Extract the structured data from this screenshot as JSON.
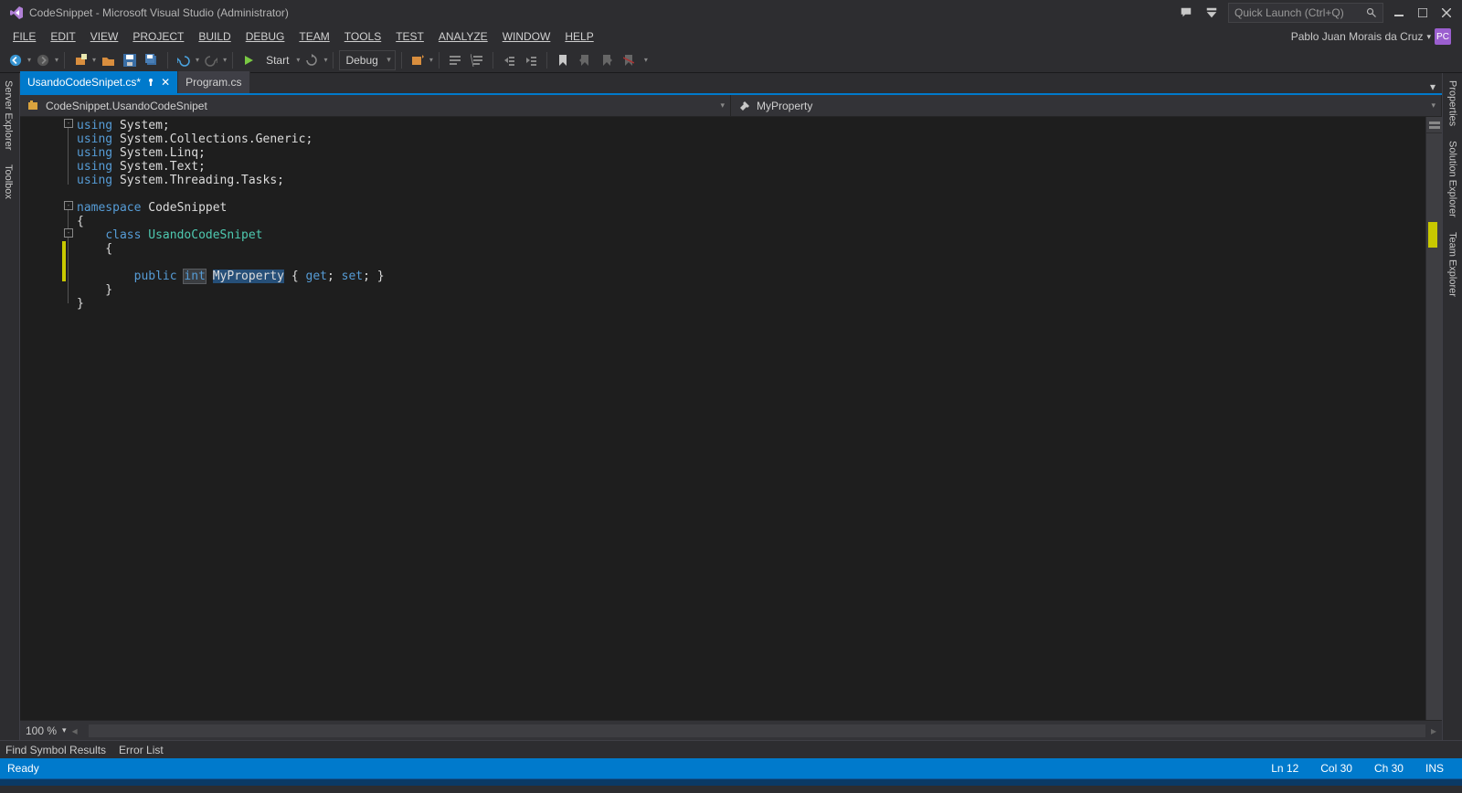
{
  "title": "CodeSnippet - Microsoft Visual Studio (Administrator)",
  "quicklaunch_placeholder": "Quick Launch (Ctrl+Q)",
  "menu": [
    "FILE",
    "EDIT",
    "VIEW",
    "PROJECT",
    "BUILD",
    "DEBUG",
    "TEAM",
    "TOOLS",
    "TEST",
    "ANALYZE",
    "WINDOW",
    "HELP"
  ],
  "user": {
    "name": "Pablo Juan Morais da Cruz",
    "initials": "PC"
  },
  "toolbar": {
    "start": "Start",
    "config": "Debug"
  },
  "left_tabs": [
    "Server Explorer",
    "Toolbox"
  ],
  "right_tabs": [
    "Properties",
    "Solution Explorer",
    "Team Explorer"
  ],
  "doc_tabs": [
    {
      "label": "UsandoCodeSnipet.cs*",
      "active": true
    },
    {
      "label": "Program.cs",
      "active": false
    }
  ],
  "nav": {
    "left": "CodeSnippet.UsandoCodeSnipet",
    "right": "MyProperty"
  },
  "code_lines": [
    {
      "t": "using",
      "r": " System;"
    },
    {
      "t": "using",
      "r": " System.Collections.Generic;"
    },
    {
      "t": "using",
      "r": " System.Linq;"
    },
    {
      "t": "using",
      "r": " System.Text;"
    },
    {
      "t": "using",
      "r": " System.Threading.Tasks;"
    },
    {
      "blank": true
    },
    {
      "t": "namespace",
      "r": " CodeSnippet"
    },
    {
      "plain": "{"
    },
    {
      "indent": "    ",
      "t": "class",
      "cls": " UsandoCodeSnipet"
    },
    {
      "plain": "    {"
    },
    {
      "blank": true
    },
    {
      "prop": true
    },
    {
      "plain": "    }"
    },
    {
      "plain": "}"
    }
  ],
  "prop": {
    "pre": "        ",
    "kw1": "public",
    "sp1": " ",
    "kw2": "int",
    "sp2": " ",
    "name": "MyProperty",
    "mid": " { ",
    "kw3": "get",
    "semi1": "; ",
    "kw4": "set",
    "semi2": "; }"
  },
  "zoom": "100 %",
  "bottom_panels": [
    "Find Symbol Results",
    "Error List"
  ],
  "status": {
    "ready": "Ready",
    "ln": "Ln 12",
    "col": "Col 30",
    "ch": "Ch 30",
    "ins": "INS"
  }
}
